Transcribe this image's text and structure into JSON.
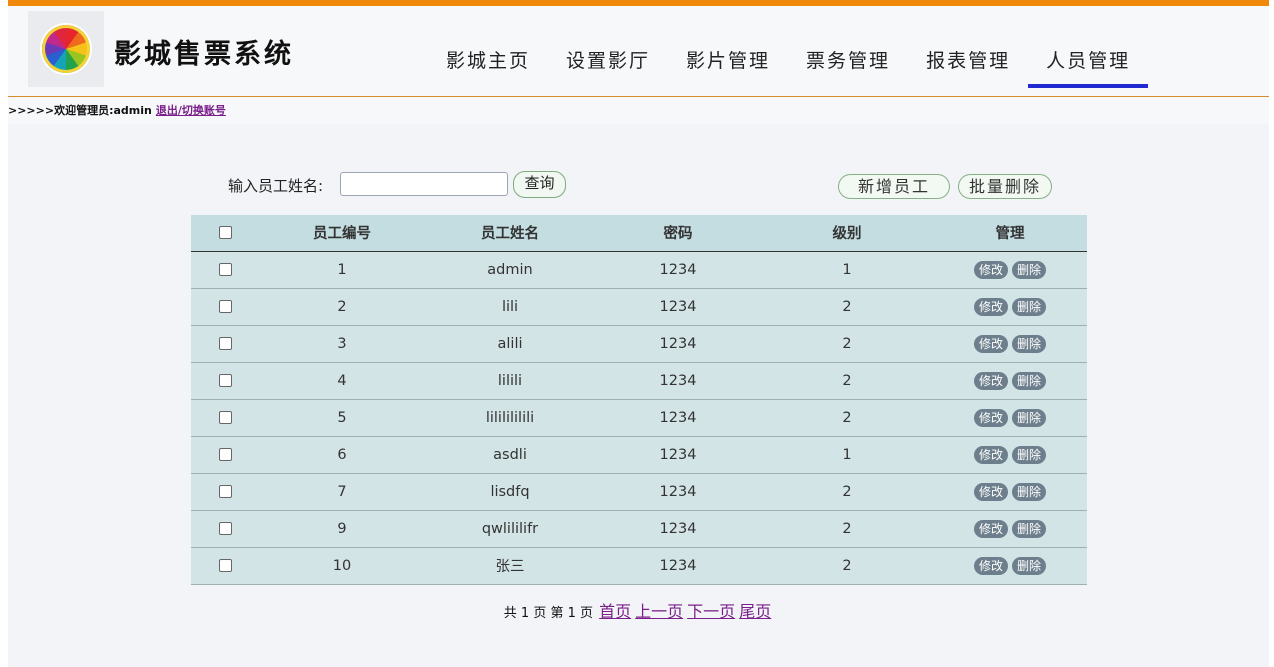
{
  "app": {
    "title": "影城售票系统"
  },
  "nav": [
    {
      "label": "影城主页"
    },
    {
      "label": "设置影厅"
    },
    {
      "label": "影片管理"
    },
    {
      "label": "票务管理"
    },
    {
      "label": "报表管理"
    },
    {
      "label": "人员管理",
      "active": true
    }
  ],
  "welcome": {
    "prefix": ">>>>>欢迎管理员:admin",
    "link": "退出/切换账号"
  },
  "search": {
    "label": "输入员工姓名:",
    "value": "",
    "placeholder": "",
    "button": "查询"
  },
  "actions": {
    "add": "新增员工",
    "batch_delete": "批量删除"
  },
  "table": {
    "headers": [
      "员工编号",
      "员工姓名",
      "密码",
      "级别",
      "管理"
    ],
    "rows": [
      {
        "id": "1",
        "name": "admin",
        "password": "1234",
        "level": "1"
      },
      {
        "id": "2",
        "name": "lili",
        "password": "1234",
        "level": "2"
      },
      {
        "id": "3",
        "name": "alili",
        "password": "1234",
        "level": "2"
      },
      {
        "id": "4",
        "name": "lilili",
        "password": "1234",
        "level": "2"
      },
      {
        "id": "5",
        "name": "lililililili",
        "password": "1234",
        "level": "2"
      },
      {
        "id": "6",
        "name": "asdli",
        "password": "1234",
        "level": "1"
      },
      {
        "id": "7",
        "name": "lisdfq",
        "password": "1234",
        "level": "2"
      },
      {
        "id": "9",
        "name": "qwlililifr",
        "password": "1234",
        "level": "2"
      },
      {
        "id": "10",
        "name": "张三",
        "password": "1234",
        "level": "2"
      }
    ],
    "edit_label": "修改",
    "delete_label": "删除"
  },
  "pager": {
    "summary": "共 1 页 第 1 页",
    "first": "首页",
    "prev": "上一页",
    "next": "下一页",
    "last": "尾页"
  },
  "colors": {
    "accent": "#f0880a",
    "nav_underline": "#1f2bd0",
    "table_header": "#c3dde1",
    "table_row": "#d3e4e7",
    "action_button": "#6d7f8c"
  }
}
